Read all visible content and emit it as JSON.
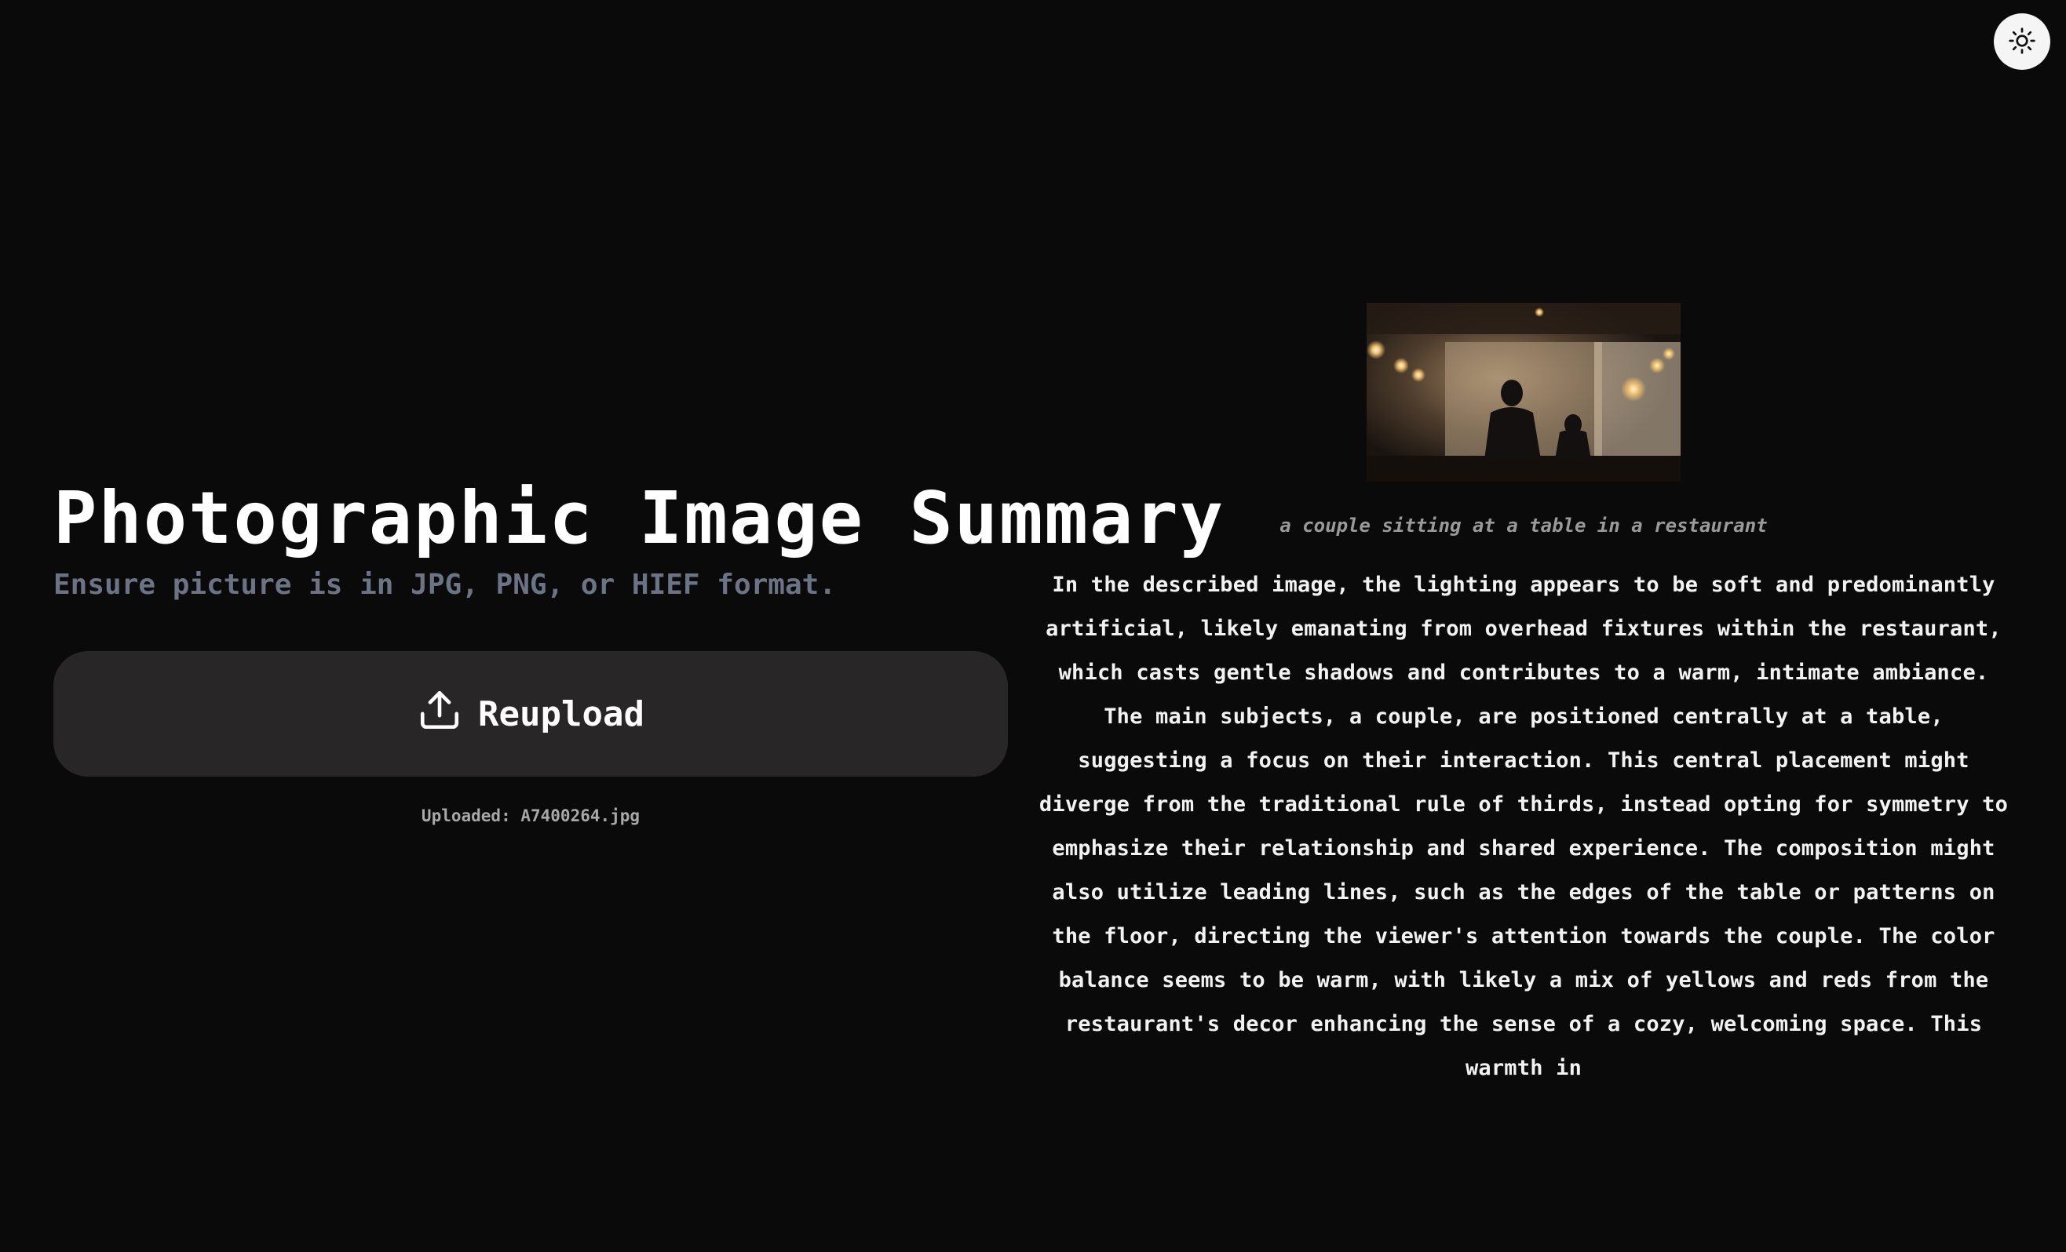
{
  "theme_toggle": {
    "icon": "sun-icon"
  },
  "header": {
    "title": "Photographic Image Summary",
    "subtitle": "Ensure picture is in JPG, PNG, or HIEF format."
  },
  "upload": {
    "button_label": "Reupload",
    "button_icon": "upload-icon",
    "uploaded_text": "Uploaded: A7400264.jpg"
  },
  "result": {
    "caption": "a couple sitting at a table in a restaurant",
    "description": "In the described image, the lighting appears to be soft and predominantly artificial, likely emanating from overhead fixtures within the restaurant, which casts gentle shadows and contributes to a warm, intimate ambiance. The main subjects, a couple, are positioned centrally at a table, suggesting a focus on their interaction. This central placement might diverge from the traditional rule of thirds, instead opting for symmetry to emphasize their relationship and shared experience. The composition might also utilize leading lines, such as the edges of the table or patterns on the floor, directing the viewer's attention towards the couple. The color balance seems to be warm, with likely a mix of yellows and reds from the restaurant's decor enhancing the sense of a cozy, welcoming space. This warmth in"
  },
  "colors": {
    "background": "#0a0a0a",
    "button_bg": "#282626",
    "subtitle": "#6b7385",
    "toggle_bg": "#f5f5f5"
  }
}
